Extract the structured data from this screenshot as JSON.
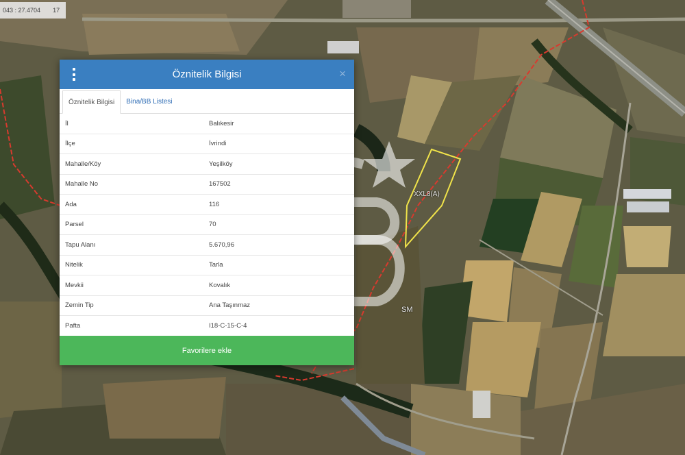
{
  "map": {
    "coordinate_readout": "043 : 27.4704",
    "zoom_level": "17",
    "parcel_label": "XXL8(A)",
    "watermark_sm": "SM"
  },
  "dialog": {
    "title": "Öznitelik Bilgisi",
    "close_symbol": "×",
    "tabs": [
      {
        "label": "Öznitelik Bilgisi",
        "active": true
      },
      {
        "label": "Bina/BB Listesi",
        "active": false
      }
    ],
    "rows": [
      {
        "key": "İl",
        "value": "Balıkesir"
      },
      {
        "key": "İlçe",
        "value": "İvrindi"
      },
      {
        "key": "Mahalle/Köy",
        "value": "Yeşilköy"
      },
      {
        "key": "Mahalle No",
        "value": "167502"
      },
      {
        "key": "Ada",
        "value": "116"
      },
      {
        "key": "Parsel",
        "value": "70"
      },
      {
        "key": "Tapu Alanı",
        "value": "5.670,96"
      },
      {
        "key": "Nitelik",
        "value": "Tarla"
      },
      {
        "key": "Mevkii",
        "value": "Kovalık"
      },
      {
        "key": "Zemin Tip",
        "value": "Ana Taşınmaz"
      },
      {
        "key": "Pafta",
        "value": "I18-C-15-C-4"
      }
    ],
    "favorite_button_label": "Favorilere ekle"
  },
  "colors": {
    "header": "#3a7fc1",
    "button": "#4cb75a",
    "boundary_line": "#d83a2e",
    "parcel_outline": "#f0e34a"
  }
}
